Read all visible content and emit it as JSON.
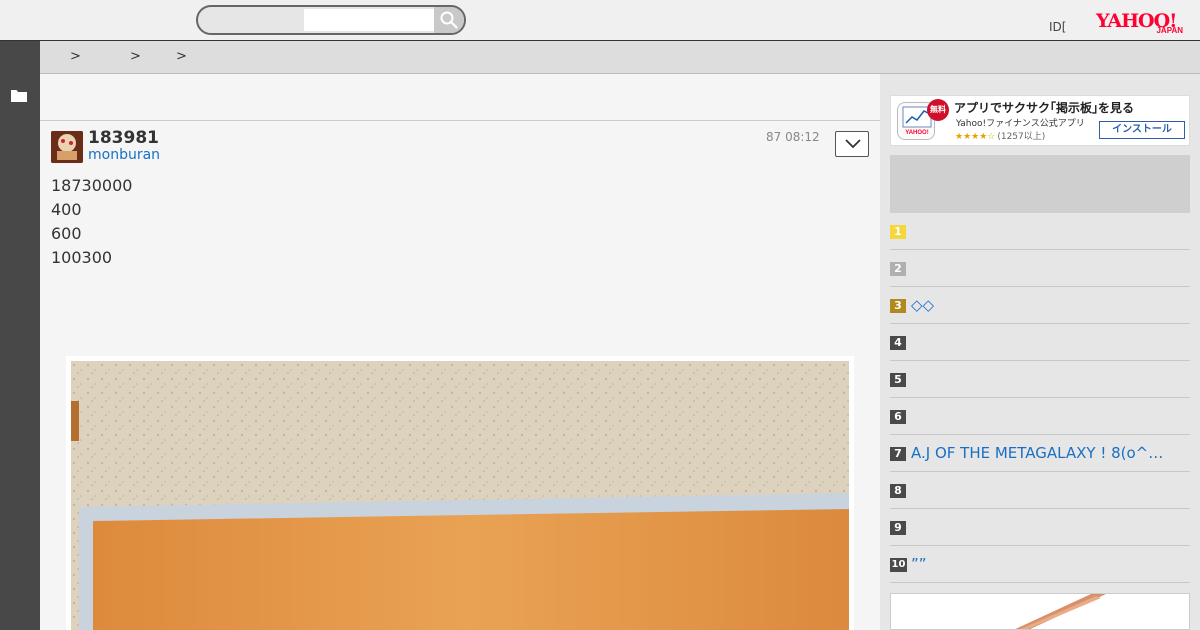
{
  "header": {
    "search_placeholder": "",
    "id_link": "ID[",
    "logo_word": "YAHOO!",
    "logo_sub": "JAPAN"
  },
  "breadcrumb": {
    "separators": [
      ">",
      ">",
      ">"
    ]
  },
  "post": {
    "number": "183981",
    "username": "monburan",
    "timestamp": "87 08:12",
    "lines": [
      "18730000",
      "400",
      "600",
      "100300"
    ]
  },
  "sidebar": {
    "app_banner": {
      "badge": "無料",
      "title": "アプリでサクサク｢掲示板｣を見る",
      "subtitle": "Yahoo!ファイナンス公式アプリ",
      "stars": "★★★★☆",
      "rating_count": "(1257以上)",
      "install_label": "インストール"
    },
    "ranking": [
      {
        "rank": "1",
        "text": "",
        "color": "#f5d63d"
      },
      {
        "rank": "2",
        "text": "",
        "color": "#b0b0b0"
      },
      {
        "rank": "3",
        "text": "◇◇",
        "color": "#b08a1e"
      },
      {
        "rank": "4",
        "text": "",
        "color": "#4a4a4a"
      },
      {
        "rank": "5",
        "text": "",
        "color": "#4a4a4a"
      },
      {
        "rank": "6",
        "text": "",
        "color": "#4a4a4a"
      },
      {
        "rank": "7",
        "text": "A.J OF THE METAGALAXY ! 8(o^…",
        "color": "#4a4a4a"
      },
      {
        "rank": "8",
        "text": "",
        "color": "#4a4a4a"
      },
      {
        "rank": "9",
        "text": "",
        "color": "#4a4a4a"
      },
      {
        "rank": "10",
        "text": "””",
        "color": "#4a4a4a"
      }
    ]
  },
  "colors": {
    "link": "#1a6fc4",
    "rail": "#484848",
    "brand": "#ff0033"
  }
}
